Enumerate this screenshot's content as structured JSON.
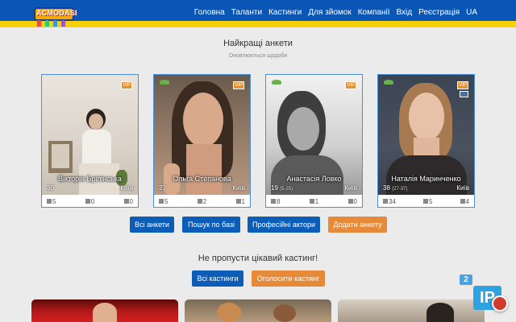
{
  "logo": {
    "text": "ACMODASI"
  },
  "nav": [
    {
      "label": "Головна"
    },
    {
      "label": "Таланти"
    },
    {
      "label": "Кастинги"
    },
    {
      "label": "Для зйомок"
    },
    {
      "label": "Компанії"
    },
    {
      "label": "Вхід"
    },
    {
      "label": "Реєстрація"
    },
    {
      "label": "UA"
    }
  ],
  "best": {
    "title": "Найкращі анкети",
    "subtitle": "Оновлюються щодоби"
  },
  "cards": [
    {
      "name": "Вікторія Брілінська",
      "age": "30",
      "age_range": "",
      "city": "Київ",
      "vip": "VIP",
      "stats": [
        "5",
        "0",
        "0"
      ]
    },
    {
      "name": "Ольга Степанова",
      "age": "27",
      "age_range": "",
      "city": "Київ",
      "vip": "VIP",
      "stats": [
        "5",
        "2",
        "1"
      ]
    },
    {
      "name": "Анастасія Ловко",
      "age": "19",
      "age_range": "(5-25)",
      "city": "Київ",
      "vip": "VIP",
      "stats": [
        "8",
        "1",
        "0"
      ]
    },
    {
      "name": "Наталія Маринченко",
      "age": "38",
      "age_range": "(27-37)",
      "city": "Київ",
      "vip": "VIP",
      "stats": [
        "34",
        "5",
        "4"
      ]
    }
  ],
  "buttons1": {
    "all": "Всі анкети",
    "search": "Пошук по базі",
    "pro": "Професійні актори",
    "add": "Додати анкету"
  },
  "castings": {
    "title": "Не пропусти цікавий кастинг!",
    "all": "Всі кастинги",
    "announce": "Оголосити кастинг"
  },
  "badge": {
    "count": "2",
    "ip": "IP"
  },
  "colors": {
    "header": "#0a56b6",
    "stripe": "#f6d000",
    "primary_button": "#0b5db8",
    "accent_button": "#e68a3a"
  }
}
